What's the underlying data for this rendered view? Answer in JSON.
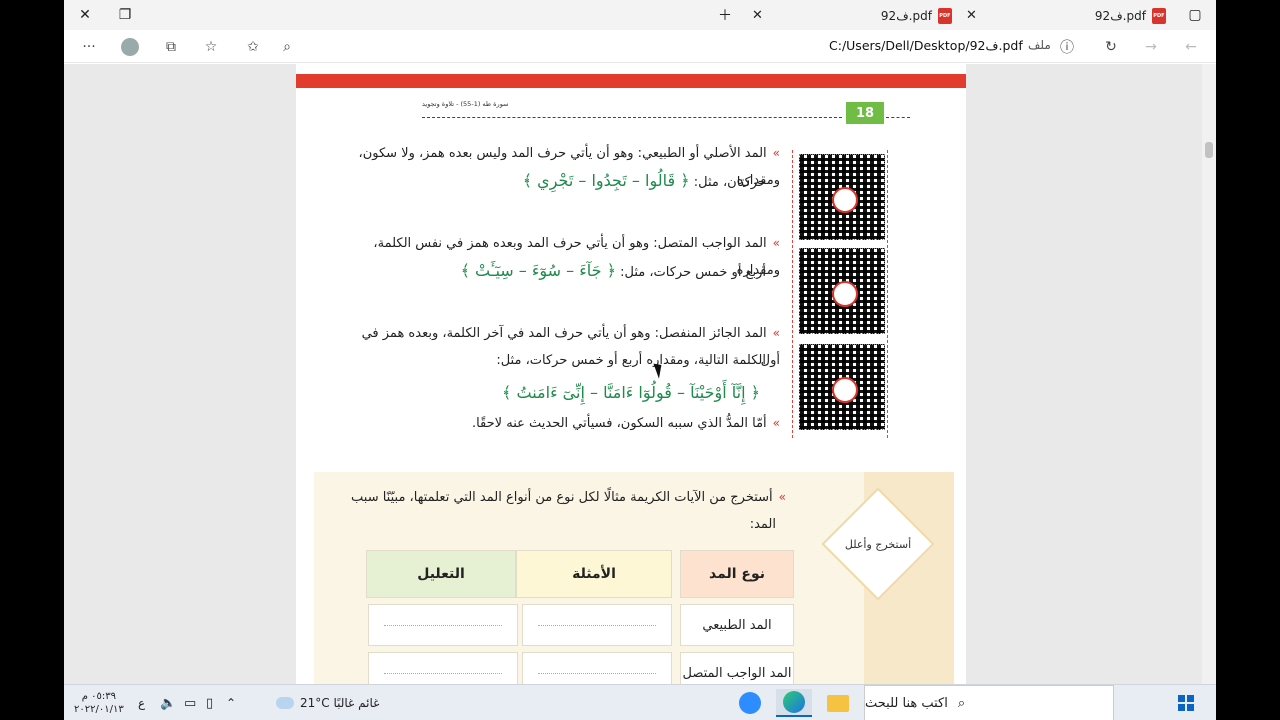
{
  "tabs": [
    {
      "label": "9ف2.pdf",
      "badge": "PDF"
    },
    {
      "label": "9ف2.pdf",
      "badge": "PDF"
    }
  ],
  "address": {
    "url": "C:/Users/Dell/Desktop/92ف.pdf",
    "file_label": "ملف"
  },
  "pdf": {
    "running_head": "سورة طه (1-55) - تلاوة وتجويد",
    "page_number": "18",
    "items": [
      {
        "line1": "المد الأصلي أو الطبيعي: وهو أن يأتي حرف المد وليس بعده همز، ولا سكون، ومقداره",
        "line2_prefix": "حركتان، مثل:",
        "examples": "﴿ قَالُوا – تَجِدُوا – تَجْرِي ﴾"
      },
      {
        "line1": "المد الواجب المتصل: وهو أن يأتي حرف المد وبعده همز في نفس الكلمة، ومقداره",
        "line2_prefix": "أربع أو خمس حركات، مثل:",
        "examples": "﴿ جَآءَ – سُوٓءَ – سِيٓـَٔتْ ﴾"
      },
      {
        "line1": "المد الجائز المنفصل: وهو أن يأتي حرف المد في آخر الكلمة، وبعده همز في أول",
        "line2_prefix": "الكلمة التالية، ومقداره أربع أو خمس حركات، مثل:",
        "examples": "﴿ إِنَّآ أَوْحَيْنَآ – قُولُوٓا ءَامَنَّا – إِنِّىٓ ءَامَنتُ ﴾"
      },
      {
        "line1": "أمّا المدُّ الذي سببه السكون، فسيأتي الحديث عنه لاحقًا.",
        "line2_prefix": "",
        "examples": ""
      }
    ],
    "activity": {
      "badge_label": "أستخرج وأعلل",
      "instruction_line1": "أستخرج من الآيات الكريمة مثالًا لكل نوع من أنواع المد التي تعلمتها، مبيّنًا سبب",
      "instruction_line2": "المد:",
      "table_headers": [
        "نوع المد",
        "الأمثلة",
        "التعليل"
      ],
      "rows": [
        "المد الطبيعي",
        "المد الواجب المتصل"
      ]
    }
  },
  "taskbar": {
    "search_placeholder": "اكتب هنا للبحث",
    "weather": "21°C  غائم غالبًا",
    "time": "٠٥:٣٩ م",
    "date": "٢٠٢٢/٠١/١٣",
    "lang": "ع"
  }
}
